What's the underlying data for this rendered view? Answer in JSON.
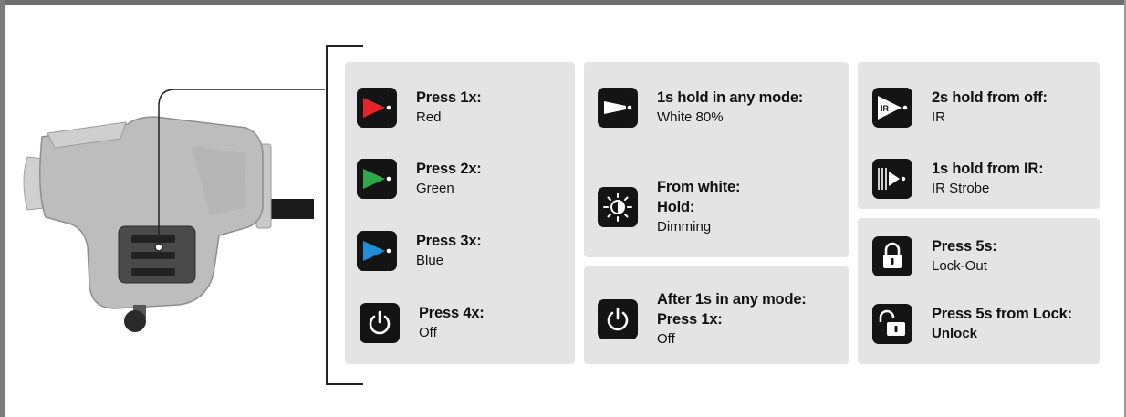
{
  "colors": {
    "red": "#e8232a",
    "green": "#2fa84a",
    "blue": "#1f8fd8",
    "panel": "#e4e4e4",
    "icon_bg": "#141414"
  },
  "groups": {
    "color_modes": [
      {
        "icon": "red-light-icon",
        "title": "Press 1x:",
        "sub": "Red"
      },
      {
        "icon": "green-light-icon",
        "title": "Press 2x:",
        "sub": "Green"
      },
      {
        "icon": "blue-light-icon",
        "title": "Press 3x:",
        "sub": "Blue"
      },
      {
        "icon": "power-icon",
        "title": "Press 4x:",
        "sub": "Off"
      }
    ],
    "white_modes": [
      {
        "icon": "white-light-icon",
        "title": "1s hold in any mode:",
        "sub": "White 80%"
      },
      {
        "icon": "dimming-icon",
        "title": "From white:",
        "title2": "Hold:",
        "sub": "Dimming"
      }
    ],
    "off_mode": {
      "icon": "power-icon",
      "title": "After 1s in any mode:",
      "title2": "Press 1x:",
      "sub": "Off"
    },
    "ir_modes": [
      {
        "icon": "ir-light-icon",
        "icon_label": "IR",
        "title": "2s hold from off:",
        "sub": "IR"
      },
      {
        "icon": "ir-strobe-icon",
        "title": "1s hold from IR:",
        "sub": "IR Strobe"
      }
    ],
    "lock_modes": [
      {
        "icon": "lock-closed-icon",
        "title": "Press 5s:",
        "sub": "Lock-Out"
      },
      {
        "icon": "lock-open-icon",
        "title": "Press 5s from Lock:",
        "sub": "Unlock"
      }
    ]
  }
}
